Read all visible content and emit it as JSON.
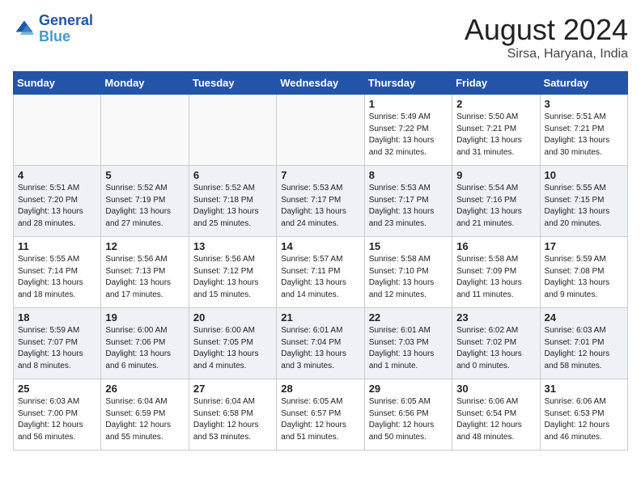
{
  "logo": {
    "brand": "General",
    "brand2": "Blue"
  },
  "title": {
    "month_year": "August 2024",
    "location": "Sirsa, Haryana, India"
  },
  "days_of_week": [
    "Sunday",
    "Monday",
    "Tuesday",
    "Wednesday",
    "Thursday",
    "Friday",
    "Saturday"
  ],
  "weeks": [
    [
      {
        "day": "",
        "info": ""
      },
      {
        "day": "",
        "info": ""
      },
      {
        "day": "",
        "info": ""
      },
      {
        "day": "",
        "info": ""
      },
      {
        "day": "1",
        "info": "Sunrise: 5:49 AM\nSunset: 7:22 PM\nDaylight: 13 hours\nand 32 minutes."
      },
      {
        "day": "2",
        "info": "Sunrise: 5:50 AM\nSunset: 7:21 PM\nDaylight: 13 hours\nand 31 minutes."
      },
      {
        "day": "3",
        "info": "Sunrise: 5:51 AM\nSunset: 7:21 PM\nDaylight: 13 hours\nand 30 minutes."
      }
    ],
    [
      {
        "day": "4",
        "info": "Sunrise: 5:51 AM\nSunset: 7:20 PM\nDaylight: 13 hours\nand 28 minutes."
      },
      {
        "day": "5",
        "info": "Sunrise: 5:52 AM\nSunset: 7:19 PM\nDaylight: 13 hours\nand 27 minutes."
      },
      {
        "day": "6",
        "info": "Sunrise: 5:52 AM\nSunset: 7:18 PM\nDaylight: 13 hours\nand 25 minutes."
      },
      {
        "day": "7",
        "info": "Sunrise: 5:53 AM\nSunset: 7:17 PM\nDaylight: 13 hours\nand 24 minutes."
      },
      {
        "day": "8",
        "info": "Sunrise: 5:53 AM\nSunset: 7:17 PM\nDaylight: 13 hours\nand 23 minutes."
      },
      {
        "day": "9",
        "info": "Sunrise: 5:54 AM\nSunset: 7:16 PM\nDaylight: 13 hours\nand 21 minutes."
      },
      {
        "day": "10",
        "info": "Sunrise: 5:55 AM\nSunset: 7:15 PM\nDaylight: 13 hours\nand 20 minutes."
      }
    ],
    [
      {
        "day": "11",
        "info": "Sunrise: 5:55 AM\nSunset: 7:14 PM\nDaylight: 13 hours\nand 18 minutes."
      },
      {
        "day": "12",
        "info": "Sunrise: 5:56 AM\nSunset: 7:13 PM\nDaylight: 13 hours\nand 17 minutes."
      },
      {
        "day": "13",
        "info": "Sunrise: 5:56 AM\nSunset: 7:12 PM\nDaylight: 13 hours\nand 15 minutes."
      },
      {
        "day": "14",
        "info": "Sunrise: 5:57 AM\nSunset: 7:11 PM\nDaylight: 13 hours\nand 14 minutes."
      },
      {
        "day": "15",
        "info": "Sunrise: 5:58 AM\nSunset: 7:10 PM\nDaylight: 13 hours\nand 12 minutes."
      },
      {
        "day": "16",
        "info": "Sunrise: 5:58 AM\nSunset: 7:09 PM\nDaylight: 13 hours\nand 11 minutes."
      },
      {
        "day": "17",
        "info": "Sunrise: 5:59 AM\nSunset: 7:08 PM\nDaylight: 13 hours\nand 9 minutes."
      }
    ],
    [
      {
        "day": "18",
        "info": "Sunrise: 5:59 AM\nSunset: 7:07 PM\nDaylight: 13 hours\nand 8 minutes."
      },
      {
        "day": "19",
        "info": "Sunrise: 6:00 AM\nSunset: 7:06 PM\nDaylight: 13 hours\nand 6 minutes."
      },
      {
        "day": "20",
        "info": "Sunrise: 6:00 AM\nSunset: 7:05 PM\nDaylight: 13 hours\nand 4 minutes."
      },
      {
        "day": "21",
        "info": "Sunrise: 6:01 AM\nSunset: 7:04 PM\nDaylight: 13 hours\nand 3 minutes."
      },
      {
        "day": "22",
        "info": "Sunrise: 6:01 AM\nSunset: 7:03 PM\nDaylight: 13 hours\nand 1 minute."
      },
      {
        "day": "23",
        "info": "Sunrise: 6:02 AM\nSunset: 7:02 PM\nDaylight: 13 hours\nand 0 minutes."
      },
      {
        "day": "24",
        "info": "Sunrise: 6:03 AM\nSunset: 7:01 PM\nDaylight: 12 hours\nand 58 minutes."
      }
    ],
    [
      {
        "day": "25",
        "info": "Sunrise: 6:03 AM\nSunset: 7:00 PM\nDaylight: 12 hours\nand 56 minutes."
      },
      {
        "day": "26",
        "info": "Sunrise: 6:04 AM\nSunset: 6:59 PM\nDaylight: 12 hours\nand 55 minutes."
      },
      {
        "day": "27",
        "info": "Sunrise: 6:04 AM\nSunset: 6:58 PM\nDaylight: 12 hours\nand 53 minutes."
      },
      {
        "day": "28",
        "info": "Sunrise: 6:05 AM\nSunset: 6:57 PM\nDaylight: 12 hours\nand 51 minutes."
      },
      {
        "day": "29",
        "info": "Sunrise: 6:05 AM\nSunset: 6:56 PM\nDaylight: 12 hours\nand 50 minutes."
      },
      {
        "day": "30",
        "info": "Sunrise: 6:06 AM\nSunset: 6:54 PM\nDaylight: 12 hours\nand 48 minutes."
      },
      {
        "day": "31",
        "info": "Sunrise: 6:06 AM\nSunset: 6:53 PM\nDaylight: 12 hours\nand 46 minutes."
      }
    ]
  ]
}
